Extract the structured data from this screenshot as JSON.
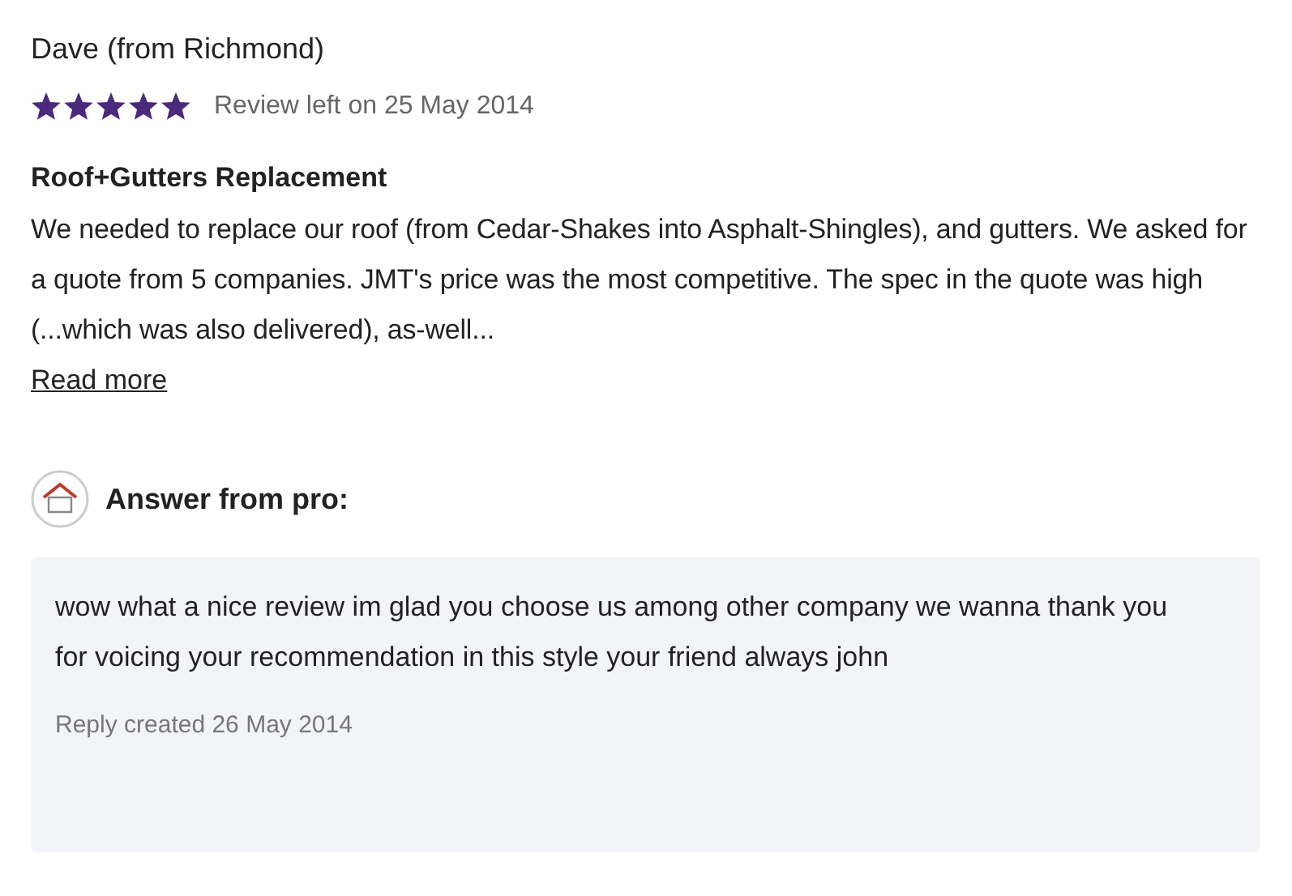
{
  "review": {
    "author": "Dave (from Richmond)",
    "stars": 5,
    "date": "Review left on 25 May 2014",
    "title": "Roof+Gutters Replacement",
    "body": "We needed to replace our roof (from Cedar-Shakes into Asphalt-Shingles), and gutters. We asked for a quote from 5 companies. JMT's price was the most competitive. The spec in the quote was high (...which was also delivered), as-well...",
    "read_more": "Read more"
  },
  "answer": {
    "heading": "Answer from pro:",
    "text": "wow what a nice review im glad you choose us among other company we wanna thank you for voicing your recommendation in this style your friend always john",
    "date": "Reply created 26 May 2014"
  }
}
